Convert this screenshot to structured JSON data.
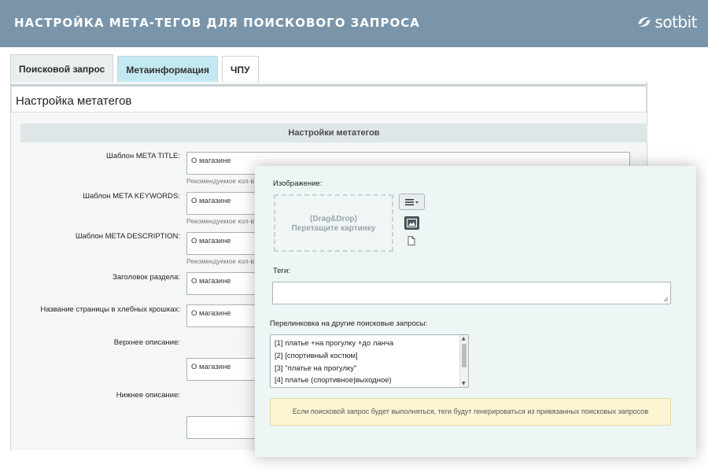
{
  "banner": {
    "title": "НАСТРОЙКА МЕТА-ТЕГОВ ДЛЯ ПОИСКОВОГО ЗАПРОСА",
    "logo_text": "sotbit",
    "bg_color": "#7a95aa"
  },
  "tabs": [
    {
      "label": "Поисковой запрос",
      "state": "active"
    },
    {
      "label": "Метаинформация",
      "state": "highlighted"
    },
    {
      "label": "ЧПУ",
      "state": "normal"
    }
  ],
  "panel": {
    "title": "Настройка метатегов",
    "section_header": "Настройки метатегов"
  },
  "form": {
    "hint": "Рекомендуемое кол-в",
    "rows": [
      {
        "label": "Шаблон META TITLE:",
        "value": "О магазине"
      },
      {
        "label": "Шаблон META KEYWORDS:",
        "value": "О магазине"
      },
      {
        "label": "Шаблон META DESCRIPTION:",
        "value": "О магазине"
      },
      {
        "label": "Заголовок раздела:",
        "value": "О магазине"
      },
      {
        "label": "Название страницы в хлебных крошках:",
        "value": "О магазине"
      },
      {
        "label": "Верхнее описание:",
        "value": "О магазине"
      },
      {
        "label": "Нижнее описание:",
        "value": ""
      }
    ]
  },
  "overlay": {
    "image_label": "Изображение:",
    "dropzone_line1": "(Drag&Drop)",
    "dropzone_line2": "Перетащите картинку",
    "tags_label": "Теги:",
    "tags_value": "",
    "links_label": "Перелинковка на другие  поисковые запросы:",
    "links": [
      "[1] платье +на прогулку +до ланча",
      "[2] [спортивный костюм]",
      "[3] \"платье на прогулку\"",
      "[4] платье (спортивное|выходное)"
    ],
    "notice": "Если поисковой запрос будет выполняться, теги будут генерироваться из привязанных поисковых запросов",
    "notice_color": "#fcf5d4"
  }
}
